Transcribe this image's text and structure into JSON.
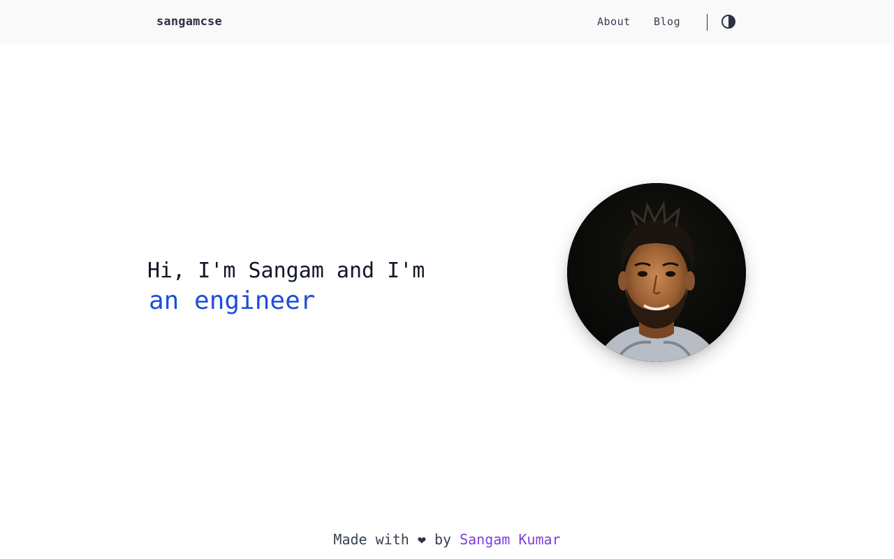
{
  "header": {
    "brand": "sangamcse",
    "nav": [
      {
        "label": "About"
      },
      {
        "label": "Blog"
      }
    ],
    "theme_toggle_icon": "contrast-icon"
  },
  "hero": {
    "greeting": "Hi, I'm Sangam and I'm",
    "role": "an engineer",
    "avatar_icon": "profile-photo"
  },
  "footer": {
    "prefix": "Made with",
    "heart_icon": "heart-icon",
    "by": "by",
    "author_link": "Sangam Kumar"
  },
  "colors": {
    "accent_blue": "#1d4ed8",
    "link_purple": "#7e3fd9",
    "text_dark": "#2d3142",
    "header_bg": "#f9f9f9"
  }
}
